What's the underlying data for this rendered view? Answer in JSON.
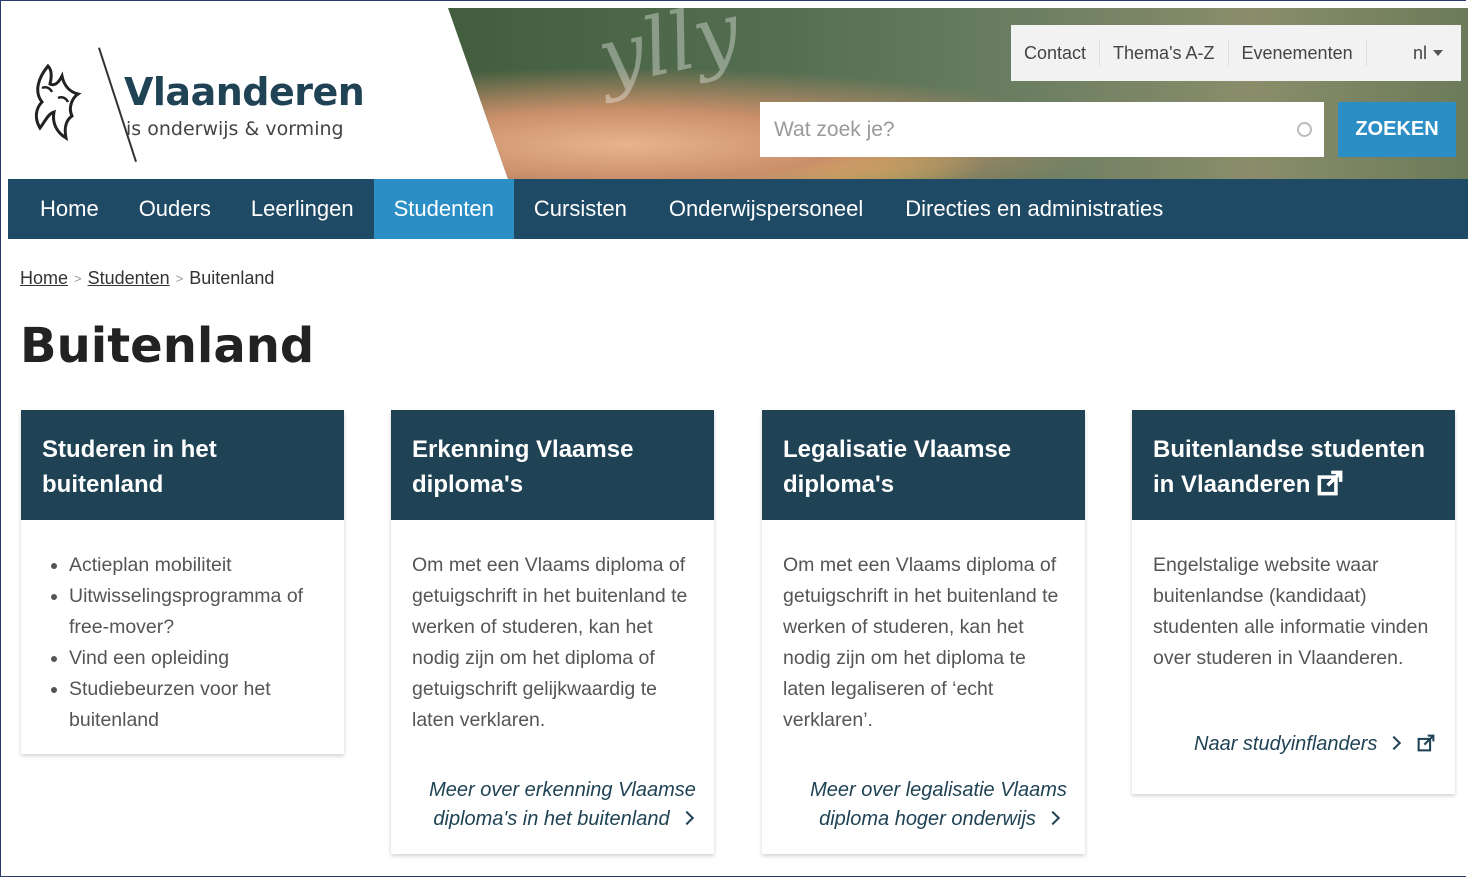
{
  "header": {
    "logo_title": "Vlaanderen",
    "logo_subtitle": "is onderwijs & vorming",
    "topnav": [
      "Contact",
      "Thema's A-Z",
      "Evenementen"
    ],
    "language": "nl",
    "search_placeholder": "Wat zoek je?",
    "search_button": "ZOEKEN"
  },
  "nav": {
    "items": [
      "Home",
      "Ouders",
      "Leerlingen",
      "Studenten",
      "Cursisten",
      "Onderwijspersoneel",
      "Directies en administraties"
    ],
    "active_index": 3
  },
  "breadcrumb": {
    "items": [
      "Home",
      "Studenten",
      "Buitenland"
    ]
  },
  "page": {
    "title": "Buitenland"
  },
  "cards": [
    {
      "title": "Studeren in het buitenland",
      "bullets": [
        "Actieplan mobiliteit",
        "Uitwisselingsprogramma of free-mover?",
        "Vind een opleiding",
        "Studiebeurzen voor het buitenland"
      ]
    },
    {
      "title": "Erkenning Vlaamse diploma's",
      "text": "Om met een Vlaams diploma of getuigschrift in het buitenland te werken of studeren, kan het nodig zijn om het diploma of getuigschrift gelijkwaardig te laten verklaren.",
      "link": "Meer over erkenning Vlaamse diploma's in het buitenland"
    },
    {
      "title": "Legalisatie Vlaamse diploma's",
      "text": "Om met een Vlaams diploma of getuigschrift in het buitenland te werken of studeren, kan het nodig zijn om het diploma te laten legaliseren of ‘echt verklaren’.",
      "link": "Meer over legalisatie Vlaams diploma hoger onderwijs"
    },
    {
      "title": "Buitenlandse studenten in Vlaanderen",
      "text": "Engelstalige website waar buitenlandse (kandidaat) studenten alle informatie vinden over studeren in Vlaanderen.",
      "link": "Naar studyinflanders"
    }
  ],
  "colors": {
    "nav_bg": "#1f4a66",
    "accent": "#2b8fc6",
    "card_head": "#1f4254"
  }
}
